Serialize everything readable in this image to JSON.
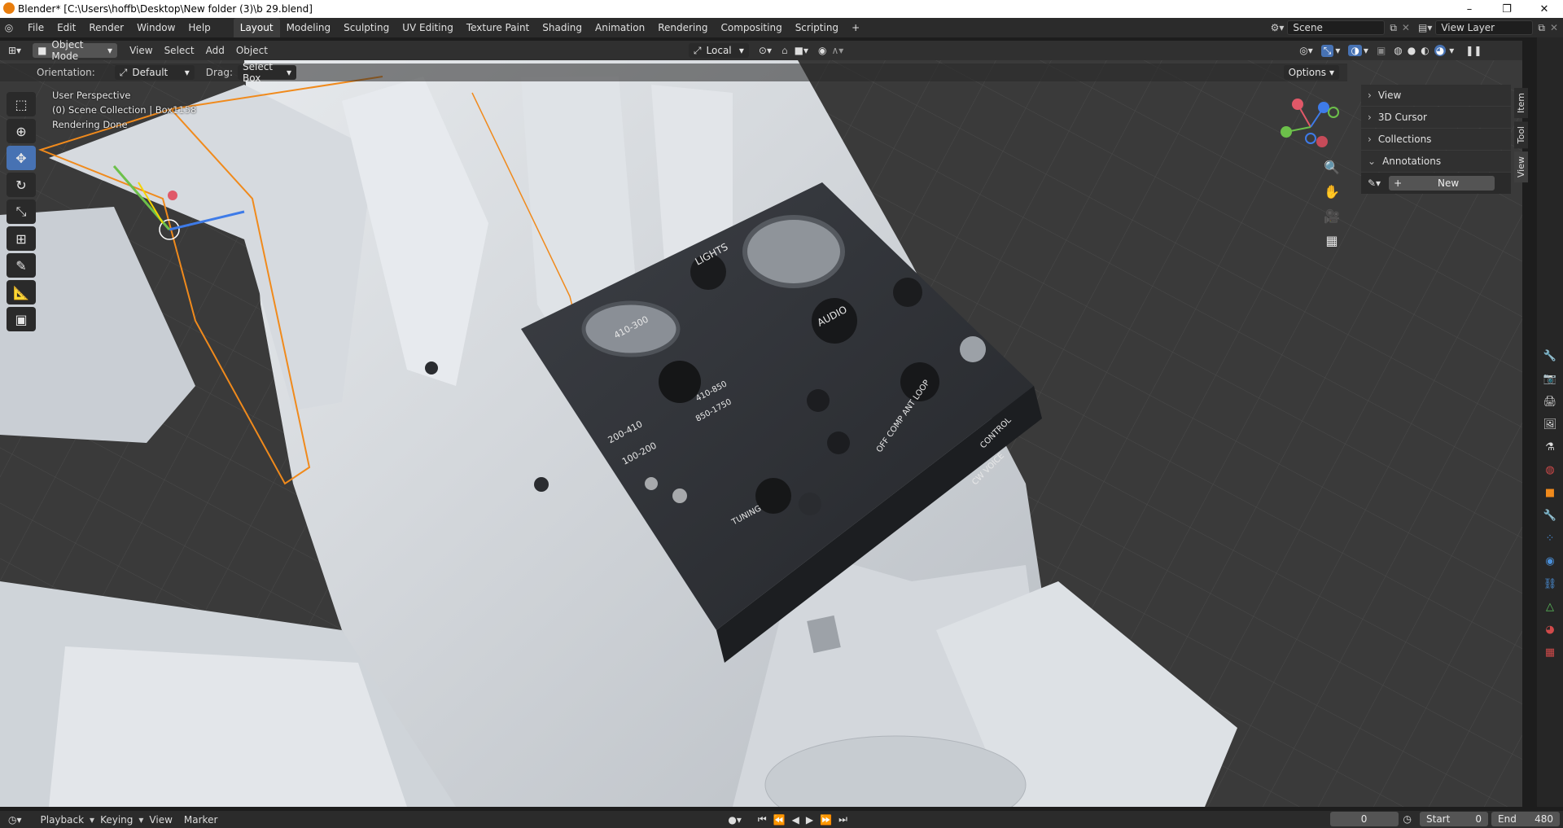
{
  "window": {
    "title": "Blender* [C:\\Users\\hoffb\\Desktop\\New folder (3)\\b 29.blend]",
    "controls": [
      "–",
      "❐",
      "✕"
    ]
  },
  "menu": [
    "File",
    "Edit",
    "Render",
    "Window",
    "Help"
  ],
  "workspaces": [
    "Layout",
    "Modeling",
    "Sculpting",
    "UV Editing",
    "Texture Paint",
    "Shading",
    "Animation",
    "Rendering",
    "Compositing",
    "Scripting",
    "+"
  ],
  "active_workspace": "Layout",
  "scene": {
    "scene_name": "Scene",
    "view_layer": "View Layer"
  },
  "viewport_header": {
    "mode": "Object Mode",
    "menus": [
      "View",
      "Select",
      "Add",
      "Object"
    ],
    "transform_orientation": "Local",
    "options_label": "Options"
  },
  "tool_settings": {
    "orientation_label": "Orientation:",
    "orientation_value": "Default",
    "drag_label": "Drag:",
    "drag_value": "Select Box"
  },
  "overlay": {
    "view_name": "User Perspective",
    "collection_info": "(0) Scene Collection | Box1158",
    "status": "Rendering Done"
  },
  "sidebar": {
    "panels": [
      "View",
      "3D Cursor",
      "Collections",
      "Annotations"
    ],
    "new_button": "New",
    "tabs": [
      "Item",
      "Tool",
      "View"
    ],
    "active_tab": "View"
  },
  "panel_labels": {
    "lights": "LIGHTS",
    "audio": "AUDIO",
    "band1": "410-300",
    "band2": "200-410",
    "band3": "100-200",
    "band4": "410-850",
    "band5": "850-1750",
    "comp": "OFF COMP ANT LOOP",
    "control": "CONTROL",
    "cw_voice": "CW VOICE",
    "tuning": "TUNING"
  },
  "timeline": {
    "menus": [
      "Playback",
      "Keying",
      "View",
      "Marker"
    ],
    "current_frame": "0",
    "start_label": "Start",
    "start_value": "0",
    "end_label": "End",
    "end_value": "480"
  },
  "colors": {
    "accent": "#4772b3",
    "selection": "#f08a1c",
    "background_dark": "#1d1d1d",
    "panel": "#303030"
  }
}
